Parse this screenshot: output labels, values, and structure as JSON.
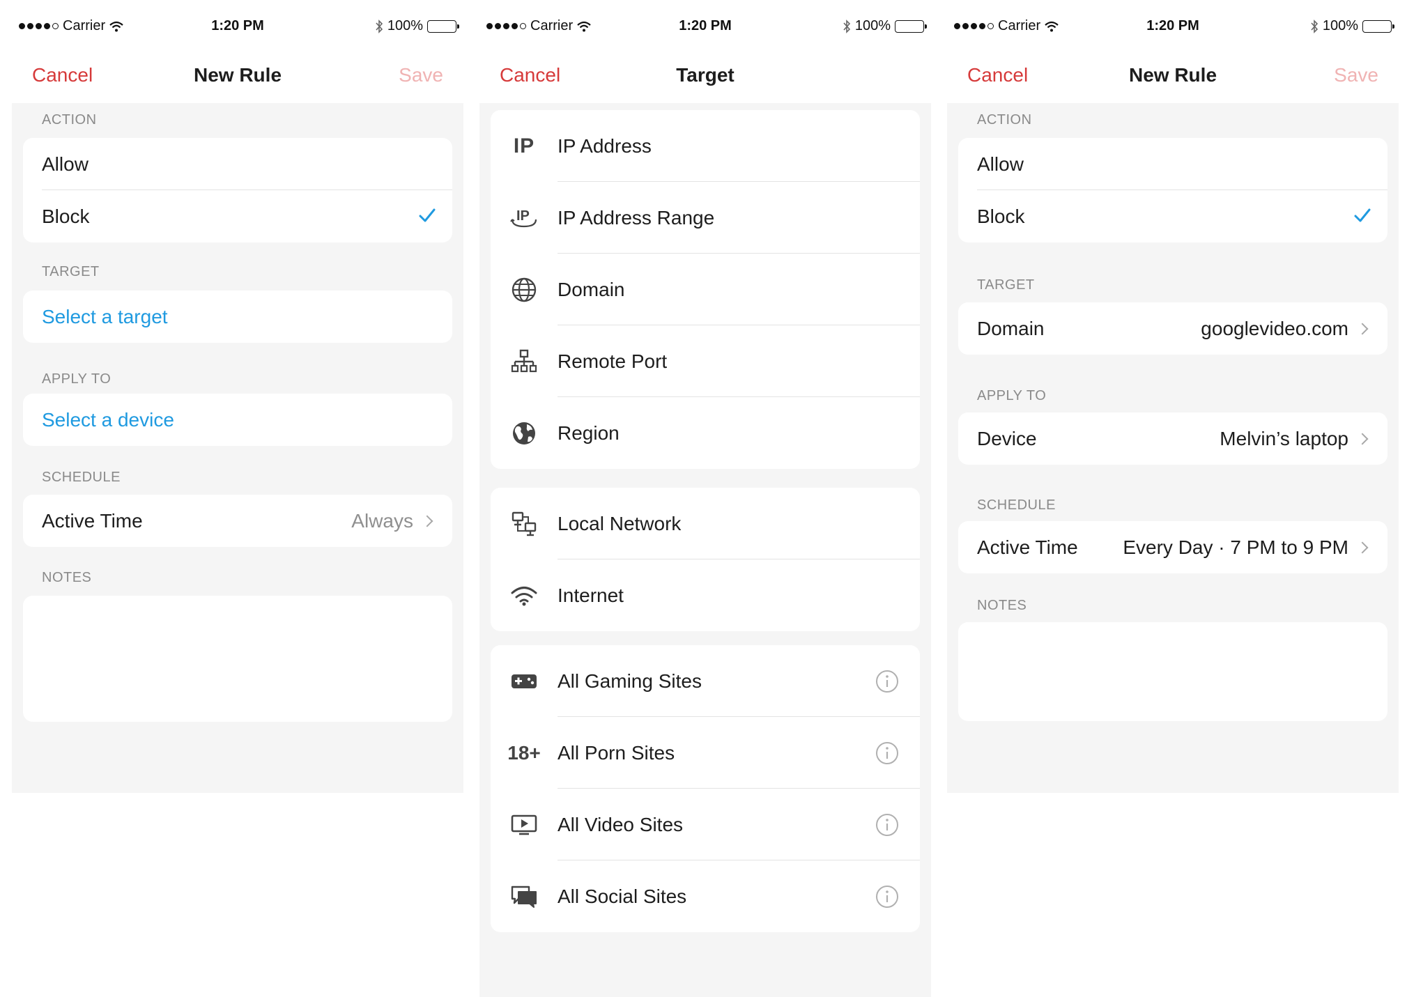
{
  "status": {
    "carrier": "Carrier",
    "time": "1:20 PM",
    "battery": "100%"
  },
  "screen1": {
    "nav": {
      "cancel": "Cancel",
      "title": "New Rule",
      "save": "Save"
    },
    "action_label": "ACTION",
    "allow": "Allow",
    "block": "Block",
    "target_label": "TARGET",
    "select_target": "Select a target",
    "apply_label": "APPLY TO",
    "select_device": "Select a device",
    "schedule_label": "SCHEDULE",
    "active_time": "Active Time",
    "active_time_value": "Always",
    "notes_label": "NOTES"
  },
  "screen2": {
    "nav": {
      "cancel": "Cancel",
      "title": "Target"
    },
    "ip_icon_text": "IP",
    "age_icon_text": "18+",
    "group1": [
      "IP Address",
      "IP Address Range",
      "Domain",
      "Remote Port",
      "Region"
    ],
    "group2": [
      "Local Network",
      "Internet"
    ],
    "group3": [
      "All Gaming Sites",
      "All Porn Sites",
      "All Video Sites",
      "All Social Sites"
    ]
  },
  "screen3": {
    "nav": {
      "cancel": "Cancel",
      "title": "New Rule",
      "save": "Save"
    },
    "action_label": "ACTION",
    "allow": "Allow",
    "block": "Block",
    "target_label": "TARGET",
    "target_key": "Domain",
    "target_value": "googlevideo.com",
    "apply_label": "APPLY TO",
    "device_key": "Device",
    "device_value": "Melvin’s laptop",
    "schedule_label": "SCHEDULE",
    "active_time": "Active Time",
    "active_time_value": "Every Day · 7 PM to 9 PM",
    "notes_label": "NOTES"
  },
  "colors": {
    "accent_red": "#d63a3a",
    "save_disabled": "#f0b3b3",
    "link_blue": "#1f9ae0",
    "check_blue": "#1f9ae0"
  }
}
